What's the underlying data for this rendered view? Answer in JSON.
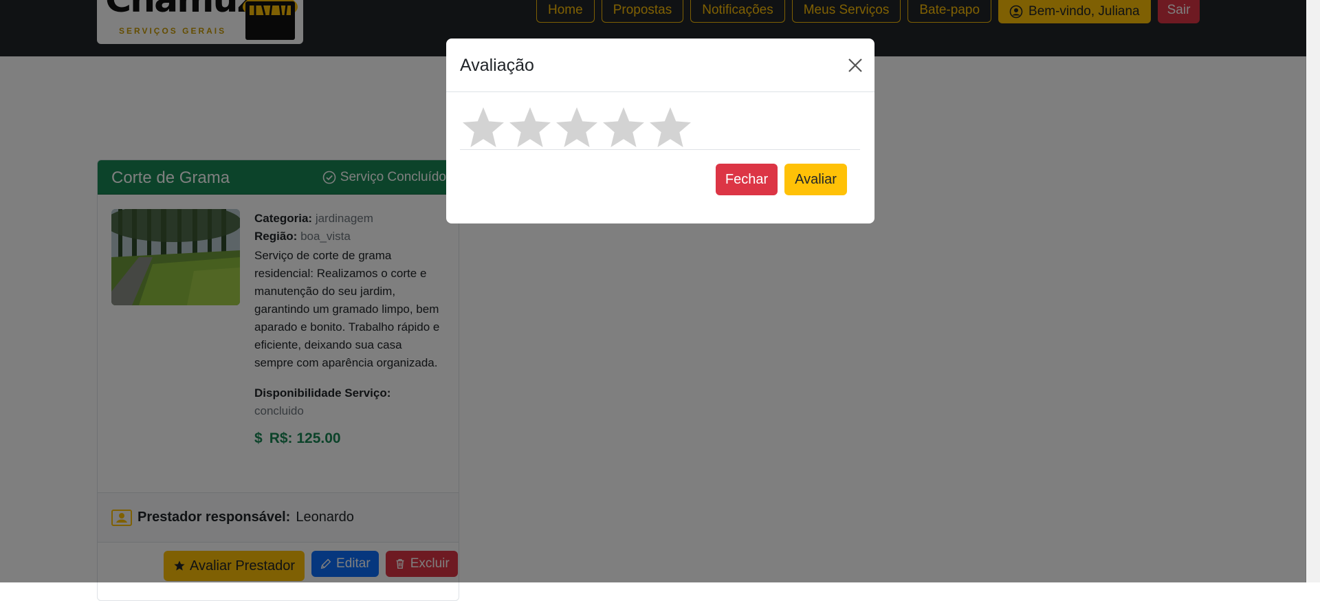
{
  "brand": {
    "name": "Chamuze",
    "tagline": "SERVIÇOS GERAIS",
    "logo_icon": "toolbox-icon"
  },
  "nav": {
    "links": [
      "Home",
      "Propostas",
      "Notificações",
      "Meus Serviços",
      "Bate-papo"
    ],
    "welcome": "Bem-vindo, Juliana",
    "welcome_icon": "user-circle-icon",
    "exit": "Sair"
  },
  "card": {
    "title": "Corte de Grama",
    "status": "Serviço Concluído",
    "status_icon": "check-circle-icon",
    "category_label": "Categoria:",
    "category_value": "jardinagem",
    "region_label": "Região:",
    "region_value": "boa_vista",
    "description": "Serviço de corte de grama residencial: Realizamos o corte e manutenção do seu jardim, garantindo um gramado limpo, bem aparado e bonito. Trabalho rápido e eficiente, deixando sua casa sempre com aparência organizada.",
    "availability_label": "Disponibilidade Serviço:",
    "availability_value": "concluido",
    "price": "R$: 125.00",
    "price_symbol": "$",
    "provider_label": "Prestador responsável:",
    "provider_value": "Leonardo",
    "provider_icon": "id-card-icon",
    "actions": {
      "rate": "Avaliar Prestador",
      "edit": "Editar",
      "delete": "Excluir"
    }
  },
  "modal": {
    "title": "Avaliação",
    "rating": 0,
    "max_rating": 5,
    "close_label": "Fechar",
    "submit_label": "Avaliar"
  },
  "colors": {
    "navbar": "#212529",
    "accent": "#ffc107",
    "danger": "#dc3545",
    "success": "#198754",
    "primary": "#0d6efd",
    "star_empty": "#d3d3d3"
  }
}
